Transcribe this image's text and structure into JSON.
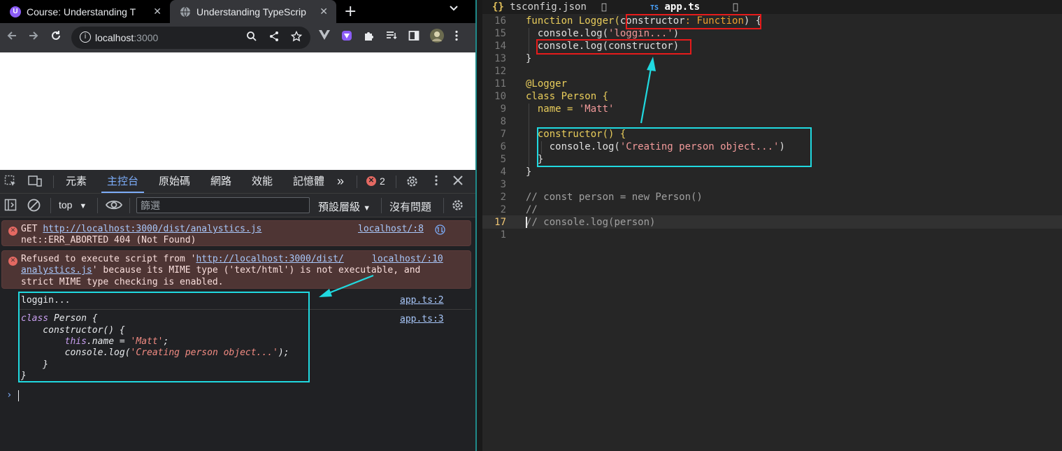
{
  "browser": {
    "tabs": [
      {
        "title": "Course: Understanding T",
        "favicon": "u-favicon",
        "favicon_text": "U",
        "favicon_color": "#8b5cf6"
      },
      {
        "title": "Understanding TypeScrip",
        "favicon": "globe-favicon",
        "favicon_text": "",
        "favicon_color": "#e8eaed"
      }
    ],
    "new_tab_glyph": "+",
    "close_glyph": "✕",
    "url": {
      "host": "localhost",
      "port": ":3000"
    }
  },
  "devtools": {
    "tabs": [
      "元素",
      "主控台",
      "原始碼",
      "網路",
      "效能",
      "記憶體"
    ],
    "active_tab": "主控台",
    "more_glyph": "»",
    "error_count": "2",
    "context": "top",
    "filter_placeholder": "篩選",
    "levels_label": "預設層級",
    "issues_label": "沒有問題"
  },
  "console": {
    "errors": [
      {
        "line1_prefix": "GET ",
        "line1_link": "http://localhost:3000/dist/analystics.js",
        "line2": "net::ERR_ABORTED 404 (Not Found)",
        "source": "localhost/:8"
      },
      {
        "line1_prefix": "Refused to execute script from '",
        "line1_link": "http://localhost:3000/dist/",
        "line2_link": "analystics.js",
        "line2_rest": "' because its MIME type ('text/html') is not executable, and",
        "line3": "strict MIME type checking is enabled.",
        "source": "localhost/:10"
      }
    ],
    "logs": [
      {
        "text": "loggin...",
        "source": "app.ts:2"
      },
      {
        "source": "app.ts:3"
      }
    ],
    "class_dump": {
      "l1_kw": "class",
      "l1_rest": " Person {",
      "l2": "    constructor() {",
      "l3_kw": "        this",
      "l3_rest": ".name = ",
      "l3_str": "'Matt'",
      "l3_end": ";",
      "l4_a": "        console.log(",
      "l4_str": "'Creating person object...'",
      "l4_end": ");",
      "l5": "    }",
      "l6": "}"
    },
    "prompt_glyph": "›"
  },
  "editor": {
    "tabs": [
      {
        "icon": "{}",
        "name": "tsconfig.json",
        "marker": "󰛒"
      },
      {
        "icon": "TS",
        "name": "app.ts",
        "marker": "󰛒"
      }
    ],
    "line_numbers": [
      "16",
      "15",
      "14",
      "13",
      "12",
      "11",
      "10",
      "9",
      "8",
      "7",
      "6",
      "5",
      "4",
      "3",
      "2",
      "17",
      "1"
    ],
    "current_line": "17",
    "code": {
      "l16_kw": "function",
      "l16_fn": " Logger(",
      "l16_param": "constructor",
      "l16_colon": ": ",
      "l16_type": "Function",
      "l16_end": ") {",
      "l15_a": "  console.log(",
      "l15_str": "'loggin...'",
      "l15_end": ")",
      "l14": "  console.log(constructor)",
      "l13": "}",
      "l11": "@Logger",
      "l10_kw": "class",
      "l10_rest": " Person {",
      "l9_a": "  name = ",
      "l9_str": "'Matt'",
      "l7": "  constructor() {",
      "l6_a": "    console.log(",
      "l6_str": "'Creating person object...'",
      "l6_end": ")",
      "l5": "  }",
      "l4": "}",
      "l2": "// const person = new Person()",
      "l1c": "//",
      "l17_slash": "/",
      "l17_rest": "/ console.log(person)"
    }
  },
  "colors": {
    "annotation_cyan": "#20d9e0",
    "annotation_red": "#e61b1b",
    "console_error_bg": "#4e3534",
    "accent_blue": "#7cacf8"
  }
}
